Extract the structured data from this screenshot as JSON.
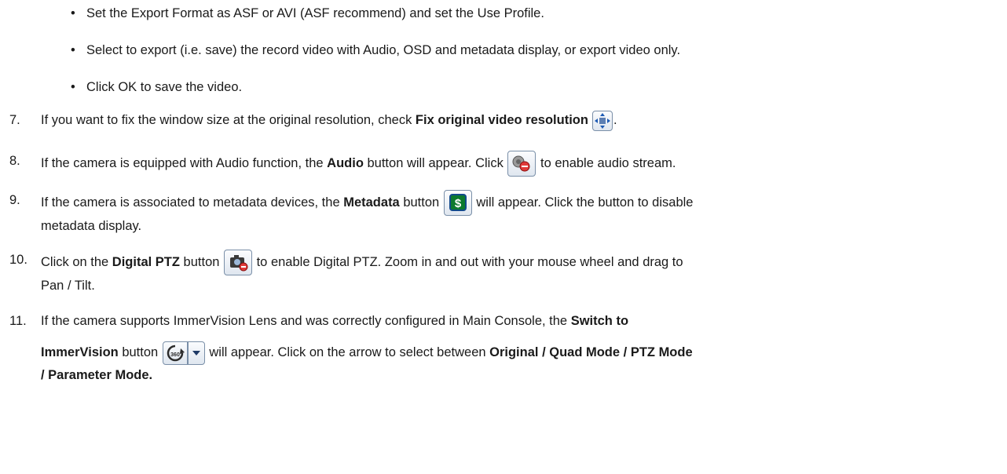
{
  "bullets": [
    "Set the Export Format as ASF or AVI (ASF recommend) and set the Use Profile.",
    "Select to export (i.e. save) the record video with Audio, OSD and metadata display, or export video only.",
    "Click OK to save the video."
  ],
  "steps": {
    "s7": {
      "num": "7.",
      "a": "If you want to fix the window size at the original resolution, check ",
      "b": "Fix original video resolution",
      "c": "."
    },
    "s8": {
      "num": "8.",
      "a": "If the camera is equipped with Audio function, the ",
      "b": "Audio",
      "c": " button will appear. Click ",
      "d": " to enable audio stream."
    },
    "s9": {
      "num": "9.",
      "a": "If the camera is associated to metadata devices, the ",
      "b": "Metadata",
      "c": " button ",
      "d": " will appear. Click the button to disable",
      "e": "metadata display."
    },
    "s10": {
      "num": "10.",
      "a": "Click on the ",
      "b": "Digital PTZ",
      "c": " button ",
      "d": " to enable Digital PTZ.  Zoom in and out with your mouse wheel and drag to",
      "e": "Pan / Tilt."
    },
    "s11": {
      "num": "11.",
      "a": "If the camera supports ImmerVision Lens and was correctly configured in Main Console, the ",
      "b": "Switch to",
      "c": "ImmerVision",
      "d": " button ",
      "e": " will appear.   Click on the arrow to select between ",
      "f": "Original / Quad Mode / PTZ Mode",
      "g": "/ Parameter Mode."
    }
  },
  "icons": {
    "fix_resolution": "move-arrows-icon",
    "audio": "audio-speaker-icon",
    "metadata": "dollar-metadata-icon",
    "digital_ptz": "camera-ptz-icon",
    "immervision": "360-rotate-icon",
    "dropdown": "chevron-down-icon"
  }
}
